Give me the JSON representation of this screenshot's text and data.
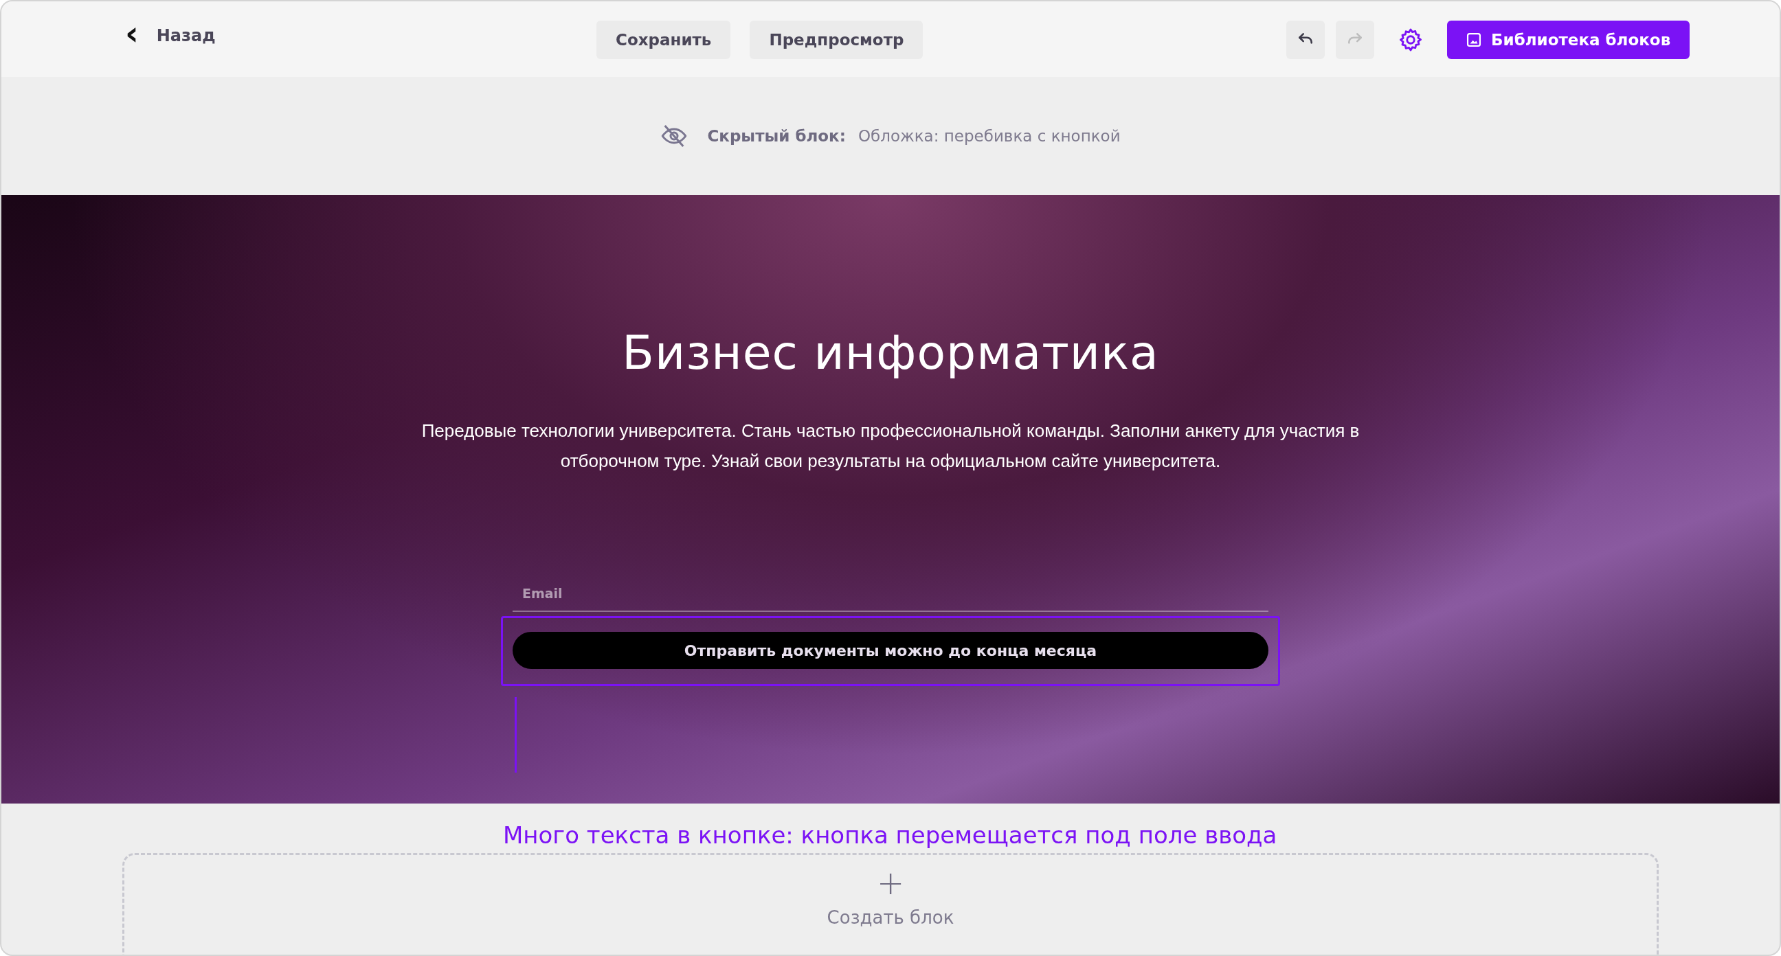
{
  "toolbar": {
    "back": {
      "icon": "‹",
      "label": "Назад"
    },
    "buttons": [
      {
        "label": "Сохранить"
      },
      {
        "label": "Предпросмотр"
      }
    ],
    "history": [
      {
        "kind": "undo",
        "disabled": false
      },
      {
        "kind": "redo",
        "disabled": true
      }
    ],
    "library_button": {
      "label": "Библиотека блоков"
    }
  },
  "hidden_notice": {
    "label": "Скрытый блок:",
    "value": "Обложка: перебивка с кнопкой"
  },
  "hero": {
    "title": "Бизнес информатика",
    "subtitle": "Передовые технологии университета. Стань частью профессиональной команды. Заполни анкету для участия в отборочном туре. Узнай свои результаты на официальном сайте университета.",
    "email": {
      "placeholder": "Email"
    },
    "submit": {
      "label": "Отправить документы можно до конца месяца"
    }
  },
  "annotation": "Много текста в кнопке: кнопка перемещается под поле ввода",
  "create_block": {
    "icon": "+",
    "label": "Создать блок"
  }
}
